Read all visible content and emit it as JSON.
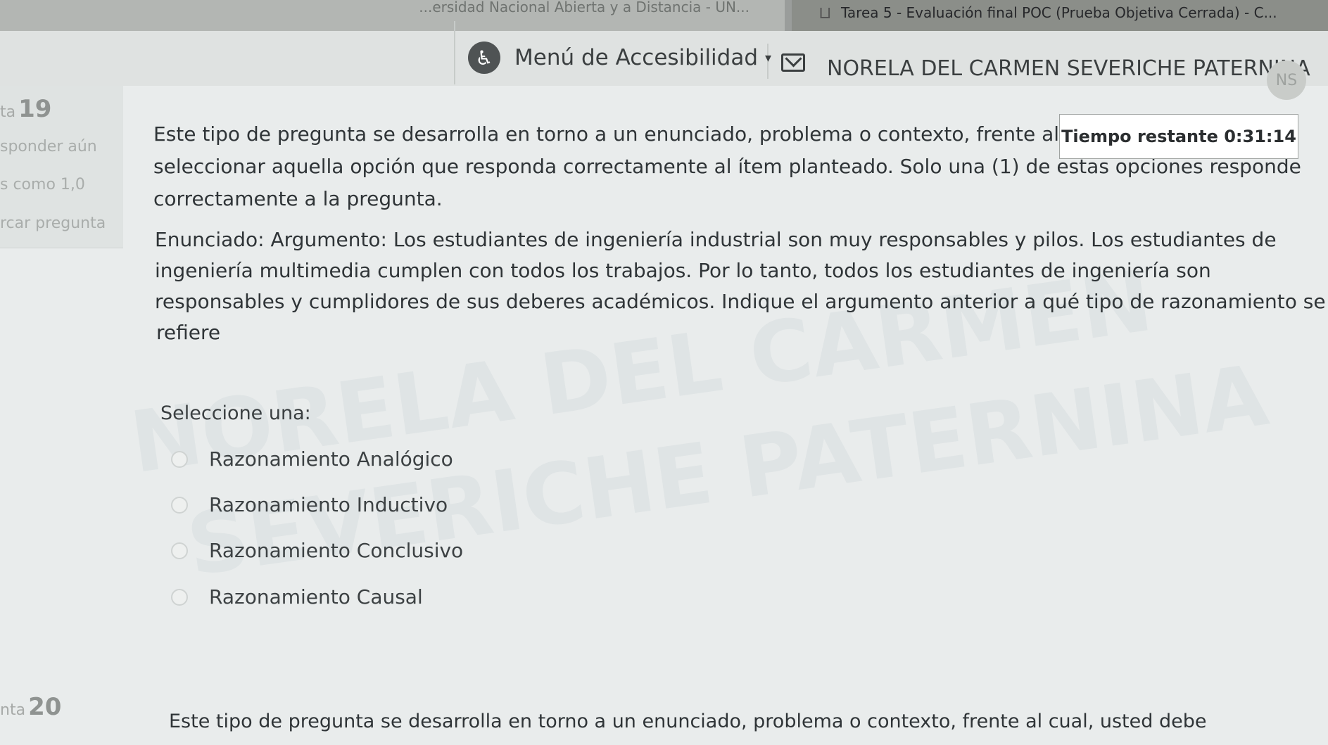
{
  "browser": {
    "tab1_title": "...ersidad Nacional Abierta y a Distancia - UN...",
    "tab2_title": "Tarea 5 - Evaluación final POC (Prueba Objetiva Cerrada) - C..."
  },
  "navbar": {
    "accessibility_label": "Menú de Accesibilidad",
    "user_name": "NORELA DEL CARMEN SEVERICHE PATERNINA",
    "avatar_initials": "NS"
  },
  "sidebar": {
    "question_prefix": "ta",
    "question_number": "19",
    "status": "sponder aún",
    "points": "s como 1,0",
    "flag": "rcar pregunta"
  },
  "timer": {
    "label": "Tiempo restante 0:31:14"
  },
  "question": {
    "intro_line1": "Este tipo de pregunta se desarrolla en torno a un enunciado, problema o contexto, frente al cua",
    "intro_line2": "seleccionar aquella opción que responda correctamente al ítem planteado. Solo una (1) de estas opciones responde",
    "intro_line3": "correctamente a la pregunta.",
    "stmt_line1": "Enunciado: Argumento: Los estudiantes de ingeniería industrial son muy responsables y pilos. Los estudiantes de",
    "stmt_line2": "ingeniería multimedia cumplen con todos los trabajos. Por lo tanto, todos los estudiantes de ingeniería son",
    "stmt_line3": "responsables y cumplidores de sus deberes académicos. Indique el argumento anterior a qué tipo de razonamiento se",
    "stmt_line4": "refiere",
    "select_label": "Seleccione una:",
    "options": [
      "Razonamiento Analógico",
      "Razonamiento Inductivo",
      "Razonamiento Conclusivo",
      "Razonamiento Causal"
    ]
  },
  "watermark": {
    "line1": "NORELA DEL CARMEN",
    "line2": "SEVERICHE PATERNINA"
  },
  "next_question": {
    "prefix": "nta",
    "number": "20",
    "intro_line1": "Este tipo de pregunta se desarrolla en torno a un enunciado, problema o contexto, frente al cual, usted debe"
  }
}
